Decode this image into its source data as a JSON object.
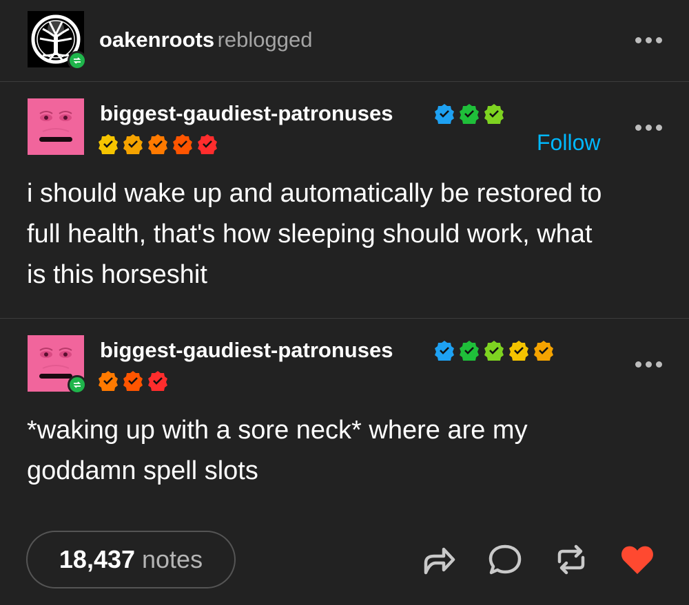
{
  "reblog_header": {
    "username": "oakenroots",
    "action": "reblogged"
  },
  "posts": [
    {
      "username": "biggest-gaudiest-patronuses",
      "follow_label": "Follow",
      "badges_row1": [
        "#1ea1f2",
        "#1fbf3a",
        "#7ed321"
      ],
      "badges_row2": [
        "#f5c400",
        "#f5a300",
        "#ff7a00",
        "#ff5500",
        "#ff2d2d"
      ],
      "text_lines": [
        "i should wake up and automatically be restored to",
        "full health, that's how sleeping should work, what",
        "is this horseshit"
      ]
    },
    {
      "username": "biggest-gaudiest-patronuses",
      "badges_row1": [
        "#1ea1f2",
        "#1fbf3a",
        "#7ed321",
        "#f5c400",
        "#f5a300"
      ],
      "badges_row2": [
        "#ff7a00",
        "#ff5500",
        "#ff2d2d"
      ],
      "text_lines": [
        "*waking up with a sore neck* where are my",
        "goddamn spell slots"
      ]
    }
  ],
  "footer": {
    "notes_count": "18,437",
    "notes_label": "notes",
    "icons": [
      "share-icon",
      "comment-icon",
      "reblog-icon",
      "like-icon"
    ],
    "like_color": "#ff4930"
  }
}
